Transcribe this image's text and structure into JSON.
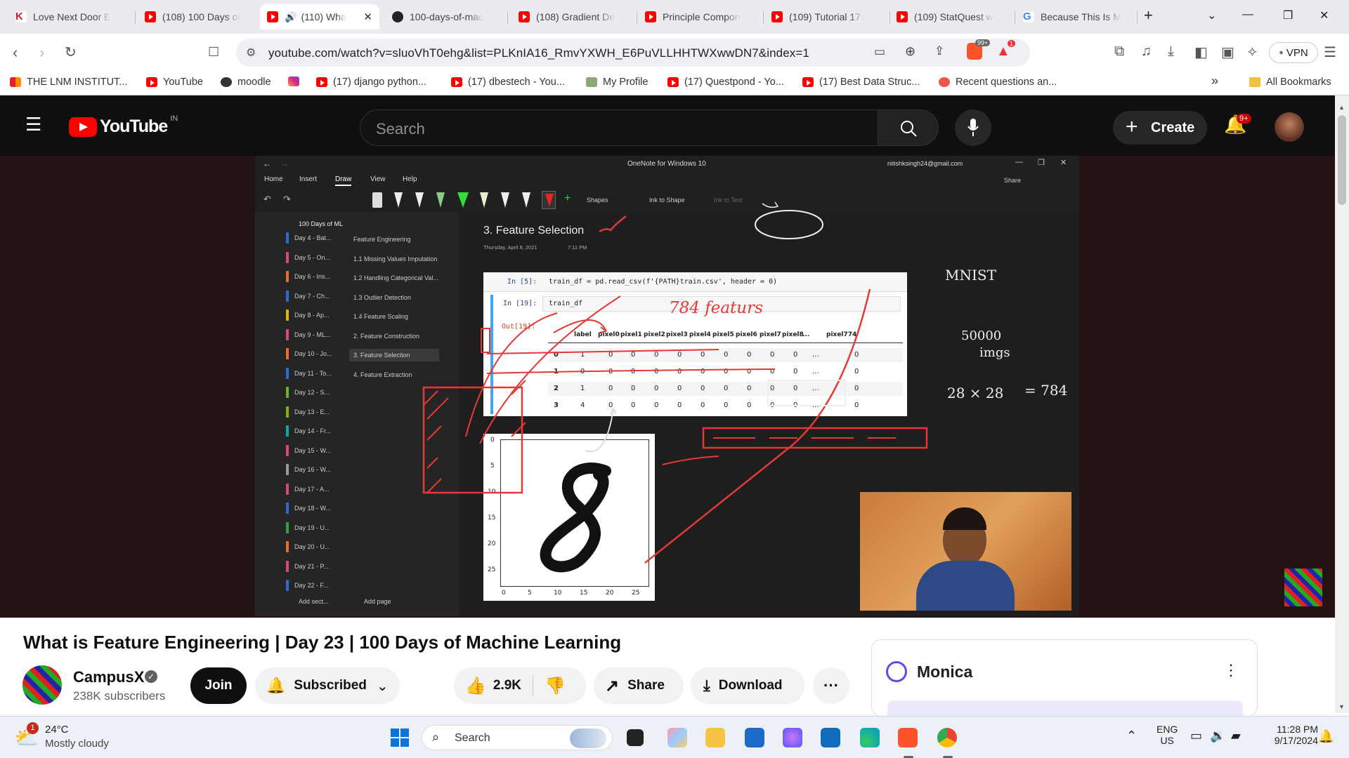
{
  "browser": {
    "tabs": [
      {
        "label": "Love Next Door E",
        "icon": "k-icon"
      },
      {
        "label": "(108) 100 Days of",
        "icon": "youtube-icon"
      },
      {
        "label": "(110) Wha",
        "icon": "youtube-icon",
        "active": true
      },
      {
        "label": "100-days-of-mac",
        "icon": "github-icon"
      },
      {
        "label": "(108) Gradient De",
        "icon": "youtube-icon"
      },
      {
        "label": "Principle Compon",
        "icon": "youtube-icon"
      },
      {
        "label": "(109) Tutorial 17-",
        "icon": "youtube-icon"
      },
      {
        "label": "(109) StatQuest w",
        "icon": "youtube-icon"
      },
      {
        "label": "Because This Is M",
        "icon": "google-icon"
      }
    ],
    "url": "youtube.com/watch?v=sluoVhT0ehg&list=PLKnIA16_RmvYXWH_E6PuVLLHHTWXwwDN7&index=1",
    "brave_badge": "99+",
    "alert_badge": "1",
    "vpn_label": "VPN",
    "bookmarks": [
      {
        "label": "THE LNM INSTITUT..."
      },
      {
        "label": "YouTube"
      },
      {
        "label": "moodle"
      },
      {
        "label": ""
      },
      {
        "label": "(17) django python..."
      },
      {
        "label": "(17) dbestech - You..."
      },
      {
        "label": "My Profile"
      },
      {
        "label": "(17) Questpond - Yo..."
      },
      {
        "label": "(17) Best Data Struc..."
      },
      {
        "label": "Recent questions an..."
      }
    ],
    "all_bookmarks": "All Bookmarks",
    "more_bookmarks": "»"
  },
  "youtube": {
    "logo_text": "YouTube",
    "region": "IN",
    "search_placeholder": "Search",
    "create_label": "Create",
    "notif_badge": "9+"
  },
  "onenote": {
    "window_title": "OneNote for Windows 10",
    "account": "nitishksingh24@gmail.com",
    "menu": [
      "Home",
      "Insert",
      "Draw",
      "View",
      "Help"
    ],
    "tools": {
      "shapes": "Shapes",
      "ink_to_shape": "Ink to Shape",
      "ink_to_text": "Ink to Text",
      "share": "Share"
    },
    "notebook": "100 Days of ML",
    "sections": [
      {
        "label": "Day 4 - Bat...",
        "color": "#2f6ad8"
      },
      {
        "label": "Day 5 - On...",
        "color": "#e0457a"
      },
      {
        "label": "Day 6 - Ins...",
        "color": "#ef6b2c"
      },
      {
        "label": "Day 7 - Ch...",
        "color": "#2f6ad8"
      },
      {
        "label": "Day 8 - Ap...",
        "color": "#e5b400"
      },
      {
        "label": "Day 9 - ML...",
        "color": "#e0457a"
      },
      {
        "label": "Day 10 - Jo...",
        "color": "#ef6b2c"
      },
      {
        "label": "Day 11 - To...",
        "color": "#2f6ad8"
      },
      {
        "label": "Day 12 - S...",
        "color": "#6bb42f"
      },
      {
        "label": "Day 13 - E...",
        "color": "#7cb400"
      },
      {
        "label": "Day 14 - Fr...",
        "color": "#1aa3a3"
      },
      {
        "label": "Day 15 - W...",
        "color": "#e0457a"
      },
      {
        "label": "Day 16 - W...",
        "color": "#9a9a9a"
      },
      {
        "label": "Day 17 - A...",
        "color": "#e0457a"
      },
      {
        "label": "Day 18 - W...",
        "color": "#2f6ad8"
      },
      {
        "label": "Day 19 - U...",
        "color": "#2e9e47"
      },
      {
        "label": "Day 20 - U...",
        "color": "#ef6b2c"
      },
      {
        "label": "Day 21 - P...",
        "color": "#e0457a"
      },
      {
        "label": "Day 22 - F...",
        "color": "#2f6ad8"
      }
    ],
    "pages": [
      "Feature Engineering",
      "1.1 Missing Values Imputation",
      "1.2 Handling Categorical Val...",
      "1.3 Outlier Detection",
      "1.4 Feature Scaling",
      "2. Feature Construction",
      "3. Feature Selection",
      "4. Feature Extraction"
    ],
    "selected_page": 6,
    "add_section": "Add sect...",
    "add_page": "Add page",
    "page_title": "3. Feature Selection",
    "page_date": "Thursday, April 8, 2021",
    "page_time": "7:11 PM",
    "code_in5_prompt": "In [5]:",
    "code_in5": "train_df = pd.read_csv(f'{PATH}train.csv', header = 0)",
    "code_in19_prompt": "In [19]:",
    "code_in19": "train_df",
    "out19_prompt": "Out[19]:",
    "df_columns": [
      "label",
      "pixel0",
      "pixel1",
      "pixel2",
      "pixel3",
      "pixel4",
      "pixel5",
      "pixel6",
      "pixel7",
      "pixel8",
      "...",
      "pixel774"
    ],
    "df_rows": [
      [
        "0",
        "1",
        "0",
        "0",
        "0",
        "0",
        "0",
        "0",
        "0",
        "0",
        "0",
        "...",
        "0"
      ],
      [
        "1",
        "0",
        "0",
        "0",
        "0",
        "0",
        "0",
        "0",
        "0",
        "0",
        "0",
        "...",
        "0"
      ],
      [
        "2",
        "1",
        "0",
        "0",
        "0",
        "0",
        "0",
        "0",
        "0",
        "0",
        "0",
        "...",
        "0"
      ],
      [
        "3",
        "4",
        "0",
        "0",
        "0",
        "0",
        "0",
        "0",
        "0",
        "0",
        "0",
        "...",
        "0"
      ]
    ],
    "digit_yticks": [
      "0",
      "5",
      "10",
      "15",
      "20",
      "25"
    ],
    "digit_xticks": [
      "0",
      "5",
      "10",
      "15",
      "20",
      "25"
    ],
    "hand_features": "784 featurs",
    "hand_mnist": "MNIST",
    "hand_count": "50000",
    "hand_imgs": "imgs",
    "hand_dims": "28 × 28",
    "hand_eq": "= 784"
  },
  "video": {
    "title": "What is Feature Engineering | Day 23 | 100 Days of Machine Learning",
    "channel": "CampusX",
    "subscribers": "238K subscribers",
    "join": "Join",
    "subscribed": "Subscribed",
    "likes": "2.9K",
    "share": "Share",
    "download": "Download",
    "more": "···"
  },
  "monica": {
    "title": "Monica",
    "menu": "⋮"
  },
  "taskbar": {
    "weather_temp": "24°C",
    "weather_desc": "Mostly cloudy",
    "weather_badge": "1",
    "search": "Search",
    "lang": "ENG",
    "region": "US",
    "time": "11:28 PM",
    "date": "9/17/2024"
  }
}
